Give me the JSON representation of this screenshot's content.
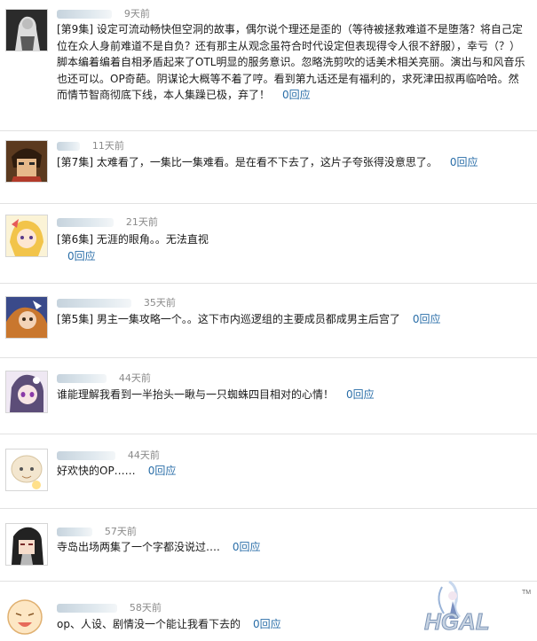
{
  "comments": [
    {
      "time": "9天前",
      "tag": "[第9集]",
      "text": " 设定可流动畅快但空洞的故事，偶尔说个理还是歪的（等待被拯救难道不是堕落？将自己定位在众人身前难道不是自负？还有那主从观念虽符合时代设定但表现得令人很不舒服），幸亏（？）脚本编着编着自相矛盾起来了OTL明显的服务意识。忽略洗剪吹的话美术相关亮丽。演出与和风音乐也还可以。OP奇葩。阴谋论大概等不着了哼。看到第九话还是有福利的，求死津田叔再临哈哈。然而情节智商彻底下线，本人集躁已极，弃了！",
      "reply": "0回应"
    },
    {
      "time": "11天前",
      "tag": "[第7集]",
      "text": " 太难看了，一集比一集难看。是在看不下去了，这片子夸张得没意思了。",
      "reply": "0回应"
    },
    {
      "time": "21天前",
      "tag": "[第6集]",
      "text": " 无涯的眼角。。无法直视",
      "reply": "0回应"
    },
    {
      "time": "35天前",
      "tag": "[第5集]",
      "text": " 男主一集攻略一个。。这下市内巡逻组的主要成员都成男主后宫了",
      "reply": "0回应"
    },
    {
      "time": "44天前",
      "tag": "",
      "text": "谁能理解我看到一半抬头一瞅与一只蜘蛛四目相对的心情！",
      "reply": "0回应"
    },
    {
      "time": "44天前",
      "tag": "",
      "text": "好欢快的OP……",
      "reply": "0回应"
    },
    {
      "time": "57天前",
      "tag": "",
      "text": "寺岛出场两集了一个字都没说过….",
      "reply": "0回应"
    },
    {
      "time": "58天前",
      "tag": "",
      "text": "op、人设、剧情没一个能让我看下去的",
      "reply": "0回应"
    }
  ],
  "watermark": "HGAL",
  "watermark_tm": "TM",
  "colors": {
    "link": "#2a6ea8",
    "time": "#8a8a8a",
    "divider": "#e2e2e2",
    "blur": "#c6d3dd"
  }
}
